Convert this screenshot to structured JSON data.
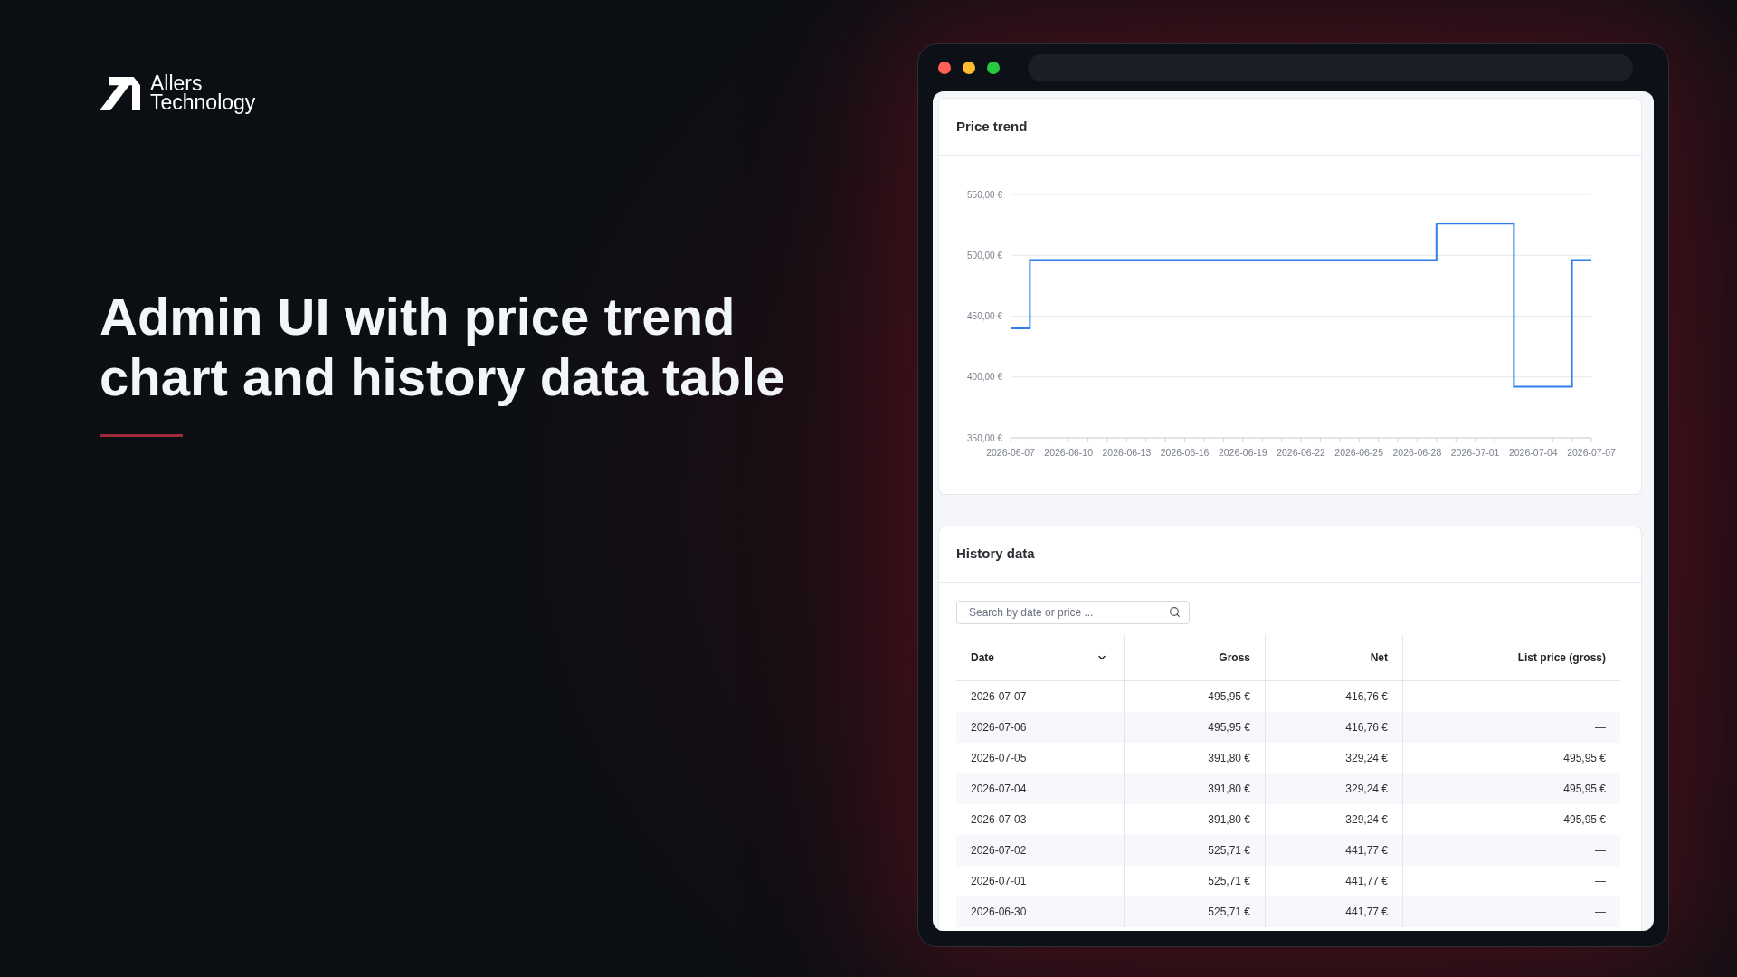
{
  "brand": {
    "lines": [
      "Allers",
      "Technology"
    ]
  },
  "headline": "Admin UI with price trend chart and history data table",
  "browser_window": {
    "price_trend": {
      "title": "Price trend",
      "chart_data": {
        "type": "line",
        "grid": true,
        "x": [
          "2026-06-07",
          "2026-06-08",
          "2026-06-08",
          "2026-06-29",
          "2026-06-29",
          "2026-07-03",
          "2026-07-03",
          "2026-07-06",
          "2026-07-06",
          "2026-07-07"
        ],
        "series": [
          {
            "color": "#2f80ed",
            "values": [
              440,
              440,
              496,
              496,
              526,
              526,
              392,
              392,
              496,
              496
            ]
          }
        ],
        "xlim": [
          "2026-06-07",
          "2026-07-07"
        ],
        "ylim": [
          350,
          550
        ],
        "xticks": [
          "2026-06-07",
          "2026-06-10",
          "2026-06-13",
          "2026-06-16",
          "2026-06-19",
          "2026-06-22",
          "2026-06-25",
          "2026-06-28",
          "2026-07-01",
          "2026-07-04",
          "2026-07-07"
        ],
        "yticks": [
          {
            "value": 350,
            "label": "350,00 €"
          },
          {
            "value": 400,
            "label": "400,00 €"
          },
          {
            "value": 450,
            "label": "450,00 €"
          },
          {
            "value": 500,
            "label": "500,00 €"
          },
          {
            "value": 550,
            "label": "550,00 €"
          }
        ]
      }
    },
    "history_data": {
      "title": "History data",
      "search": {
        "placeholder": "Search by date or price ..."
      },
      "table": {
        "columns": [
          {
            "label": "Date",
            "sorted": true
          },
          {
            "label": "Gross",
            "sorted": false
          },
          {
            "label": "Net",
            "sorted": false
          },
          {
            "label": "List price (gross)",
            "sorted": false
          }
        ],
        "rows": [
          [
            "2026-07-07",
            "495,95 €",
            "416,76 €",
            "—"
          ],
          [
            "2026-07-06",
            "495,95 €",
            "416,76 €",
            "—"
          ],
          [
            "2026-07-05",
            "391,80 €",
            "329,24 €",
            "495,95 €"
          ],
          [
            "2026-07-04",
            "391,80 €",
            "329,24 €",
            "495,95 €"
          ],
          [
            "2026-07-03",
            "391,80 €",
            "329,24 €",
            "495,95 €"
          ],
          [
            "2026-07-02",
            "525,71 €",
            "441,77 €",
            "—"
          ],
          [
            "2026-07-01",
            "525,71 €",
            "441,77 €",
            "—"
          ],
          [
            "2026-06-30",
            "525,71 €",
            "441,77 €",
            "—"
          ]
        ]
      }
    }
  }
}
